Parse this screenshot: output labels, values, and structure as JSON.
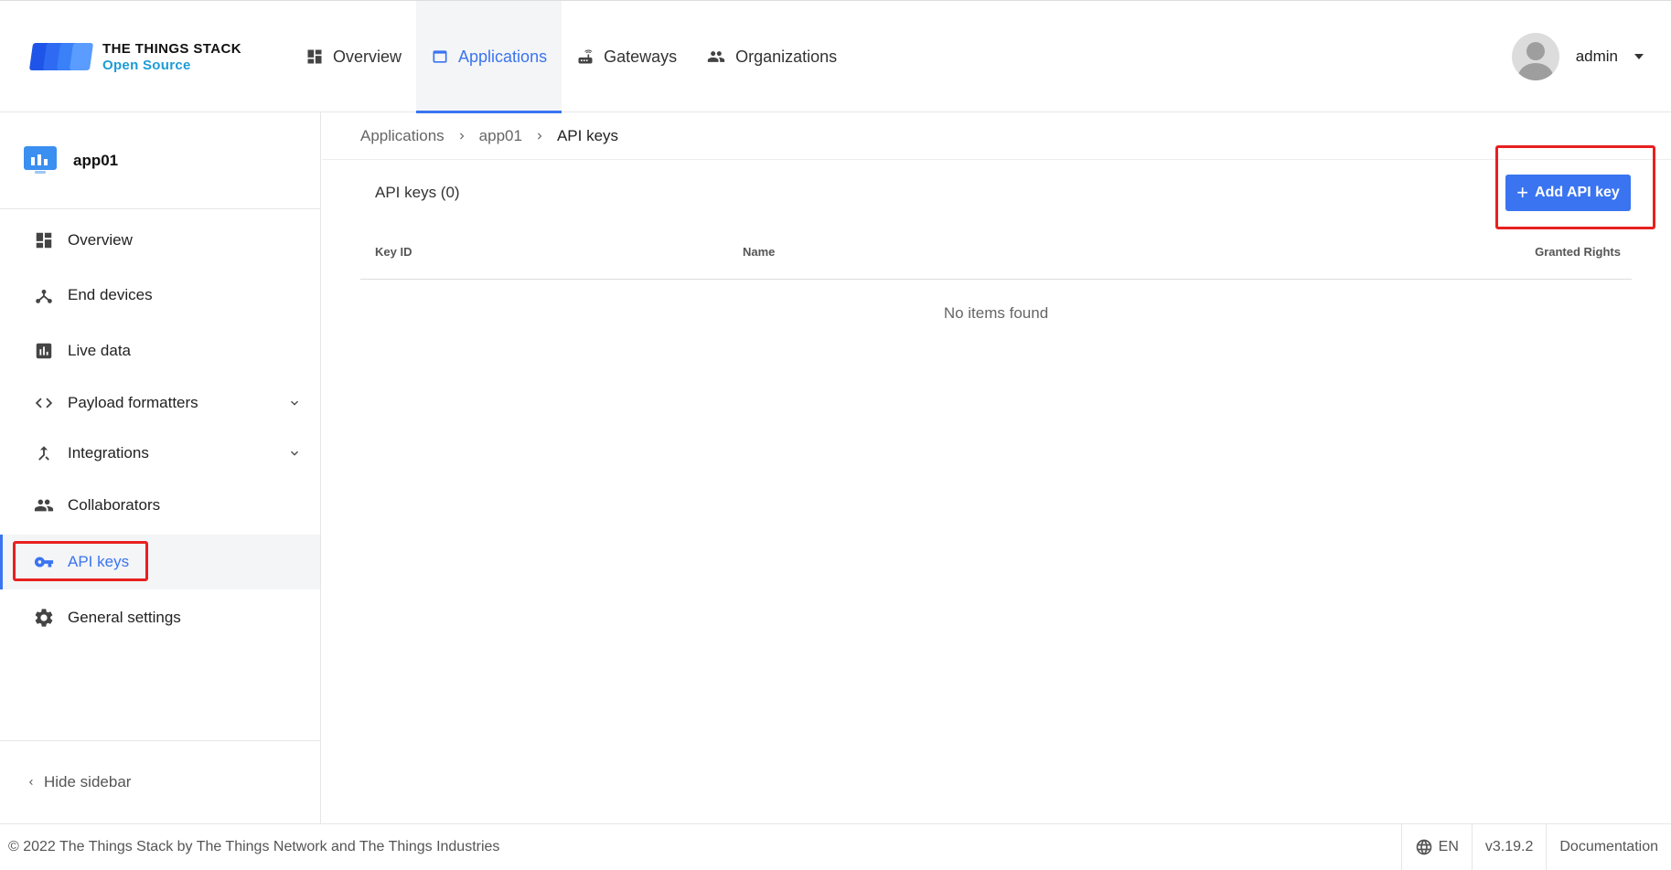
{
  "brand": {
    "title": "THE THINGS STACK",
    "subtitle": "Open Source",
    "colors": [
      "#1e55e8",
      "#3a80f7",
      "#6aa8ff"
    ]
  },
  "topnav": {
    "items": [
      {
        "label": "Overview",
        "icon": "dashboard-icon"
      },
      {
        "label": "Applications",
        "icon": "window-icon",
        "active": true
      },
      {
        "label": "Gateways",
        "icon": "router-icon"
      },
      {
        "label": "Organizations",
        "icon": "people-icon"
      }
    ]
  },
  "user": {
    "name": "admin"
  },
  "sidebar": {
    "app_name": "app01",
    "items": [
      {
        "label": "Overview",
        "icon": "dashboard-icon"
      },
      {
        "label": "End devices",
        "icon": "device-network-icon"
      },
      {
        "label": "Live data",
        "icon": "bar-chart-icon"
      },
      {
        "label": "Payload formatters",
        "icon": "code-icon",
        "expandable": true
      },
      {
        "label": "Integrations",
        "icon": "merge-icon",
        "expandable": true
      },
      {
        "label": "Collaborators",
        "icon": "people-icon"
      },
      {
        "label": "API keys",
        "icon": "key-icon",
        "active": true
      },
      {
        "label": "General settings",
        "icon": "gear-icon"
      }
    ],
    "hide_label": "Hide sidebar"
  },
  "breadcrumb": {
    "items": [
      "Applications",
      "app01",
      "API keys"
    ]
  },
  "table": {
    "title": "API keys (0)",
    "add_button": "Add API key",
    "columns": [
      "Key ID",
      "Name",
      "Granted Rights"
    ],
    "empty_text": "No items found"
  },
  "footer": {
    "copyright": "© 2022 The Things Stack by The Things Network and The Things Industries",
    "language": "EN",
    "version": "v3.19.2",
    "docs": "Documentation"
  },
  "accent_color": "#3a74f0",
  "annotation_color": "#e82020"
}
